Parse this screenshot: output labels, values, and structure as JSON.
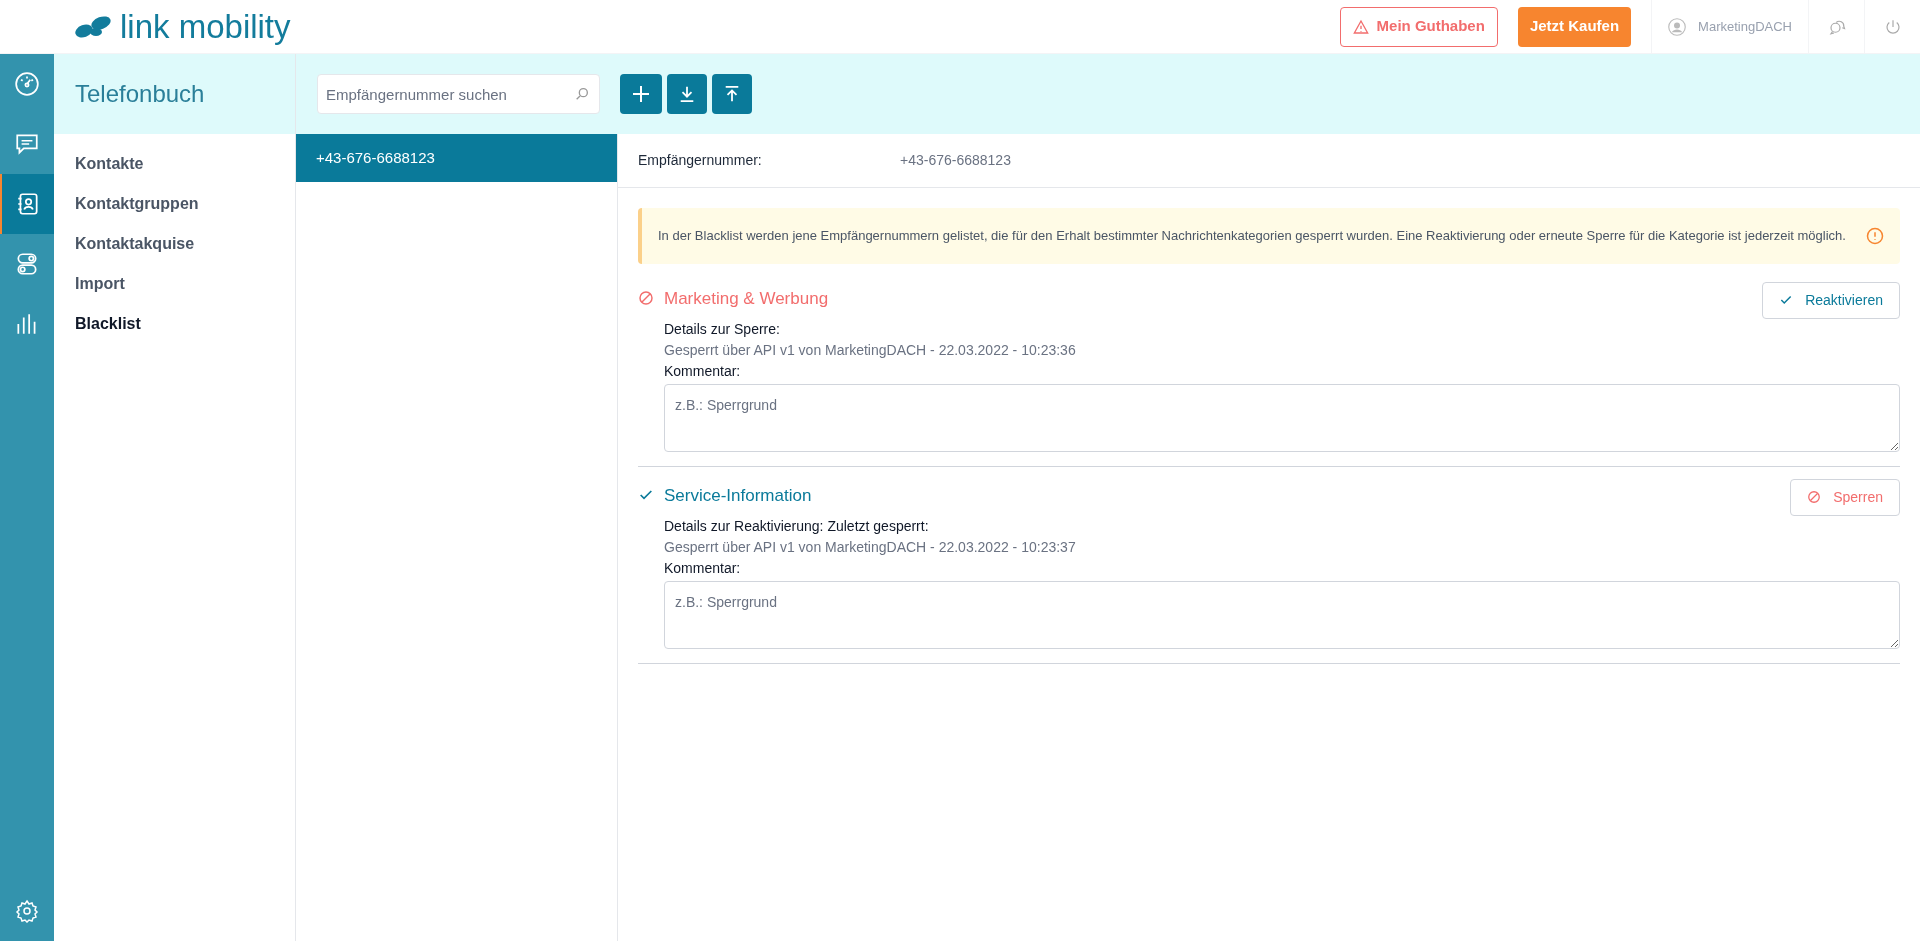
{
  "header": {
    "logo": "link mobility",
    "balance_button": "Mein Guthaben",
    "buy_button": "Jetzt Kaufen",
    "user": "MarketingDACH"
  },
  "rail": [
    {
      "kind": "dashboard",
      "selected": false
    },
    {
      "kind": "messages",
      "selected": false
    },
    {
      "kind": "contacts",
      "selected": true
    },
    {
      "kind": "toggles",
      "selected": false
    },
    {
      "kind": "stats",
      "selected": false
    }
  ],
  "section_title": "Telefonbuch",
  "nav": [
    {
      "label": "Kontakte",
      "selected": false
    },
    {
      "label": "Kontaktgruppen",
      "selected": false
    },
    {
      "label": "Kontaktakquise",
      "selected": false
    },
    {
      "label": "Import",
      "selected": false
    },
    {
      "label": "Blacklist",
      "selected": true
    }
  ],
  "search": {
    "placeholder": "Empfängernummer suchen"
  },
  "numbers": [
    {
      "label": "+43-676-6688123",
      "selected": true
    }
  ],
  "detail": {
    "number_label": "Empfängernummer:",
    "number_value": "+43-676-6688123",
    "notice": "In der Blacklist werden jene Empfängernummern gelistet, die für den Erhalt bestimmter Nachrichtenkategorien gesperrt wurden. Eine Reaktivierung oder erneute Sperre für die Kategorie ist jederzeit möglich.",
    "categories": [
      {
        "kind": "blocked",
        "title": "Marketing & Werbung",
        "details_label": "Details zur Sperre:",
        "details": "Gesperrt über API v1 von MarketingDACH - 22.03.2022 - 10:23:36",
        "comment_label": "Kommentar:",
        "comment_placeholder": "z.B.: Sperrgrund",
        "button": "Reaktivieren"
      },
      {
        "kind": "active",
        "title": "Service-Information",
        "details_label": "Details zur Reaktivierung: Zuletzt gesperrt:",
        "details": "Gesperrt über API v1 von MarketingDACH - 22.03.2022 - 10:23:37",
        "comment_label": "Kommentar:",
        "comment_placeholder": "z.B.: Sperrgrund",
        "button": "Sperren"
      }
    ]
  }
}
